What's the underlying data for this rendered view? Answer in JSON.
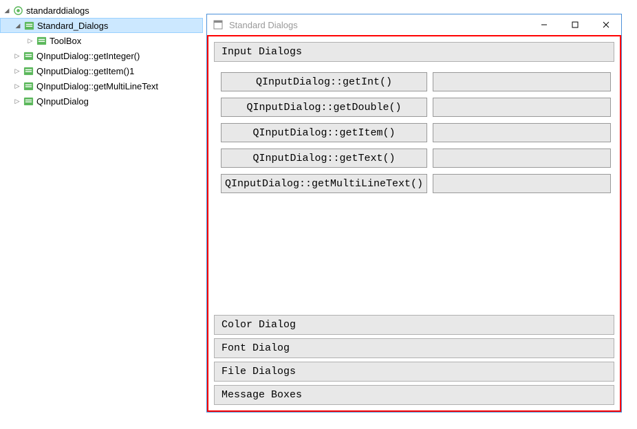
{
  "tree": {
    "root": "standarddialogs",
    "items": [
      {
        "label": "Standard_Dialogs",
        "selected": true
      },
      {
        "label": "ToolBox"
      },
      {
        "label": "QInputDialog::getInteger()"
      },
      {
        "label": "QInputDialog::getItem()1"
      },
      {
        "label": "QInputDialog::getMultiLineText"
      },
      {
        "label": "QInputDialog"
      }
    ]
  },
  "window": {
    "title": "Standard Dialogs"
  },
  "groups": {
    "input_dialogs": {
      "title": "Input Dialogs",
      "buttons": [
        "QInputDialog::getInt()",
        "QInputDialog::getDouble()",
        "QInputDialog::getItem()",
        "QInputDialog::getText()",
        "QInputDialog::getMultiLineText()"
      ]
    },
    "color": {
      "title": "Color Dialog"
    },
    "font": {
      "title": "Font Dialog"
    },
    "file": {
      "title": "File Dialogs"
    },
    "message": {
      "title": "Message Boxes"
    }
  }
}
